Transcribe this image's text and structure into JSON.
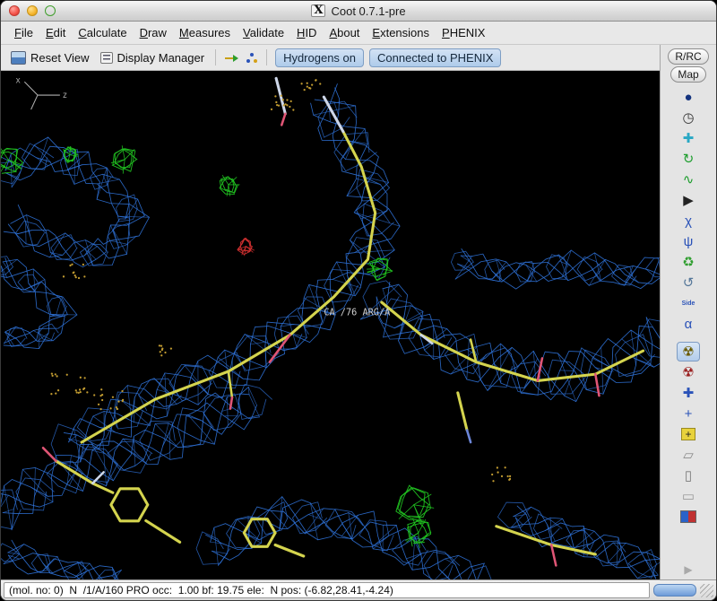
{
  "window": {
    "title": "Coot 0.7.1-pre",
    "x11_badge": "X"
  },
  "menu": {
    "items": [
      "File",
      "Edit",
      "Calculate",
      "Draw",
      "Measures",
      "Validate",
      "HID",
      "About",
      "Extensions",
      "PHENIX"
    ]
  },
  "toolbar": {
    "reset_view_label": "Reset View",
    "display_manager_label": "Display Manager",
    "hydrogens_label": "Hydrogens on",
    "phenix_label": "Connected to PHENIX"
  },
  "right_panel": {
    "rrc_label": "R/RC",
    "map_label": "Map",
    "expand_glyph": "▶",
    "tools": [
      {
        "name": "sphere-icon",
        "glyph": "●",
        "color": "#14337e"
      },
      {
        "name": "clock-icon",
        "glyph": "◷",
        "color": "#333333"
      },
      {
        "name": "move-axes-icon",
        "glyph": "✚",
        "color": "#29a8c4"
      },
      {
        "name": "rotate-zone-icon",
        "glyph": "↻",
        "color": "#1e9e2e"
      },
      {
        "name": "torsion-icon",
        "glyph": "∿",
        "color": "#1e9e2e"
      },
      {
        "name": "pointer-icon",
        "glyph": "▶",
        "color": "#222222"
      },
      {
        "name": "chi-angles-icon",
        "glyph": "χ",
        "color": "#2a52b8"
      },
      {
        "name": "flip-peptide-icon",
        "glyph": "ψ",
        "color": "#2a52b8"
      },
      {
        "name": "recycle-icon",
        "glyph": "♻",
        "color": "#2e9e2e"
      },
      {
        "name": "undo-model-icon",
        "glyph": "↺",
        "color": "#557799"
      },
      {
        "name": "sidechain-icon",
        "glyph": "Side",
        "color": "#2a52b8",
        "tiny": true
      },
      {
        "name": "autofit-rotamer-icon",
        "glyph": "α",
        "color": "#2a52b8"
      }
    ],
    "tools_lower": [
      {
        "name": "radiation-icon",
        "glyph": "☢",
        "color": "#6a5a00",
        "active": true
      },
      {
        "name": "radiation-dark-icon",
        "glyph": "☢",
        "color": "#9a2020"
      },
      {
        "name": "axes-cross-icon",
        "glyph": "✚",
        "color": "#2a52b8"
      },
      {
        "name": "label-cross-icon",
        "glyph": "+",
        "color": "#2a52b8"
      },
      {
        "name": "add-residue-icon",
        "glyph": "+",
        "color": "#222222",
        "boxed": true
      },
      {
        "name": "eraser-icon",
        "glyph": "▱",
        "color": "#8a8a8a"
      },
      {
        "name": "trash-icon",
        "glyph": "▯",
        "color": "#777777"
      },
      {
        "name": "cylinder-icon",
        "glyph": "▭",
        "color": "#999999"
      },
      {
        "name": "display-issues-icon",
        "type": "swatch",
        "colors": [
          "#2a62c8",
          "#c03232"
        ]
      }
    ]
  },
  "canvas": {
    "residue_label": "CA /76 ARG/A",
    "axes": {
      "x": "x",
      "z": "z"
    },
    "colors": {
      "mesh": "#2f72d8",
      "positive": "#21c421",
      "negative": "#d23030",
      "carbon": "#d4d44e",
      "light": "#cdd6e8",
      "oxygen": "#e05575",
      "nitrogen": "#6c86d8",
      "dots": "#c09a30",
      "axes": "#b0b0b0"
    }
  },
  "statusbar": {
    "text": "(mol. no: 0)  N  /1/A/160 PRO occ:  1.00 bf: 19.75 ele:  N pos: (-6.82,28.41,-4.24)"
  }
}
